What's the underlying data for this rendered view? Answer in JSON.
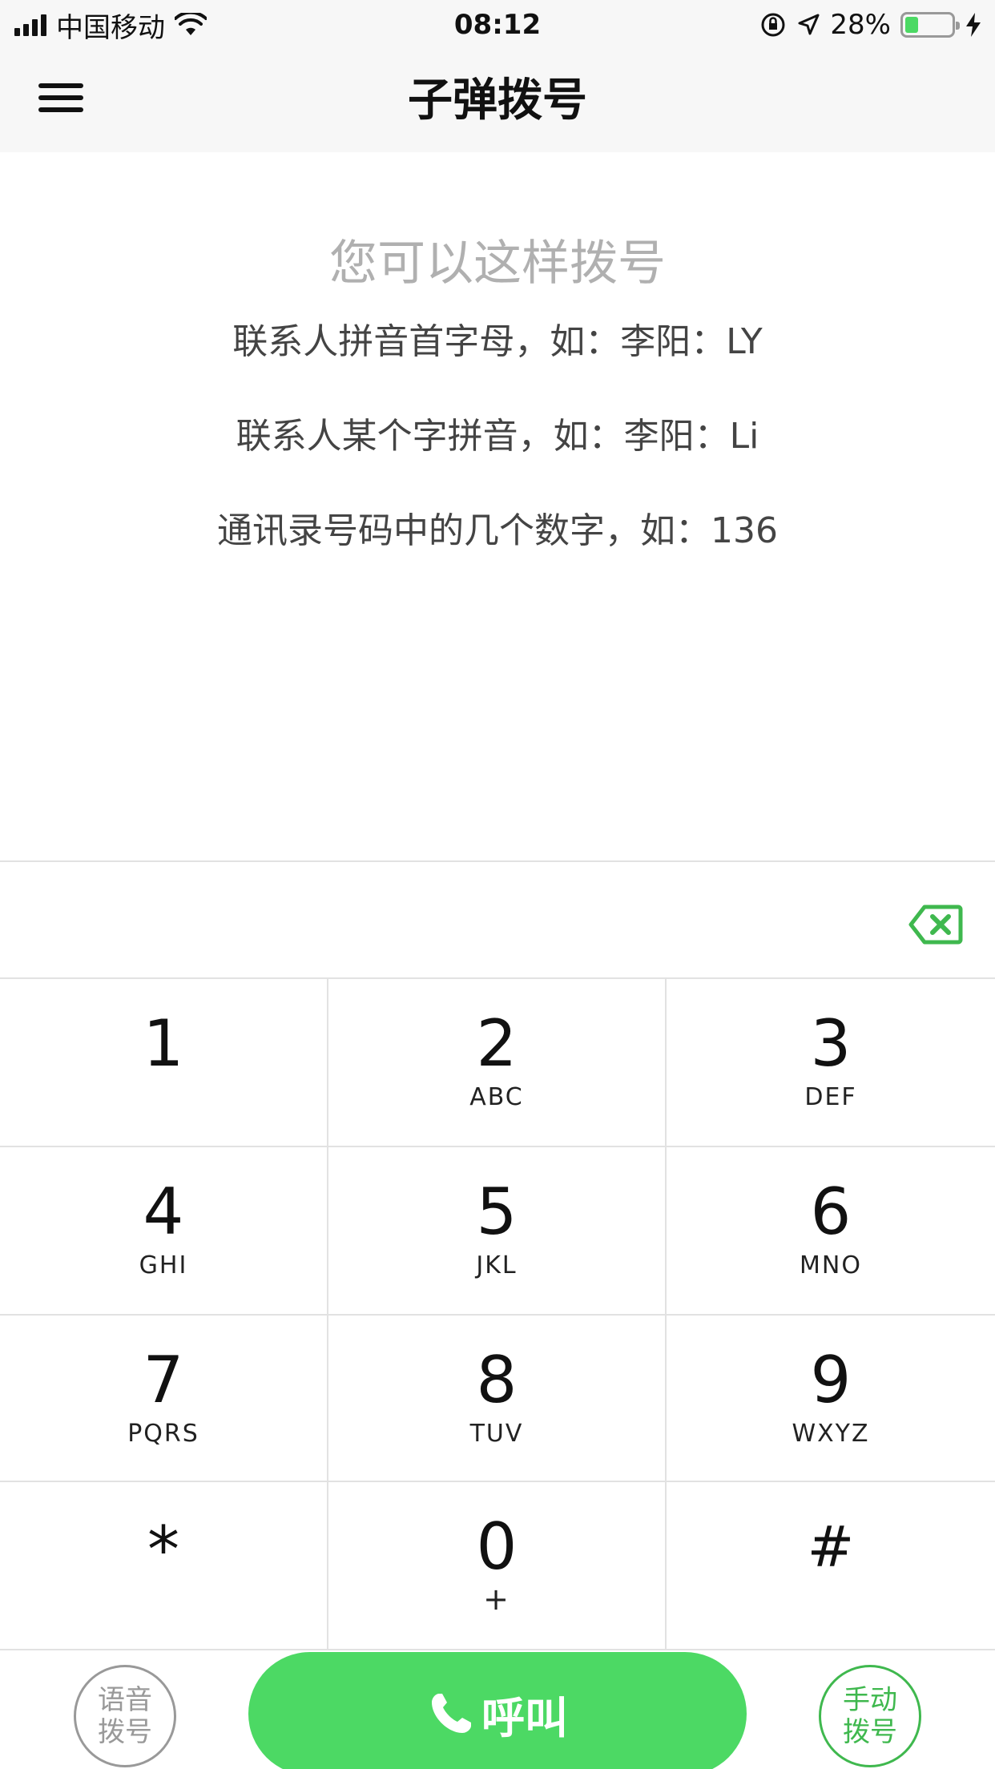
{
  "status_bar": {
    "carrier": "中国移动",
    "time": "08:12",
    "battery_percent": "28%",
    "battery_level": 0.28
  },
  "nav": {
    "title": "子弹拨号"
  },
  "hint": {
    "title": "您可以这样拨号",
    "lines": [
      "联系人拼音首字母，如：李阳：LY",
      "联系人某个字拼音，如：李阳：Li",
      "通讯录号码中的几个数字，如：136"
    ]
  },
  "keypad": {
    "keys": [
      {
        "digit": "1",
        "letters": ""
      },
      {
        "digit": "2",
        "letters": "ABC"
      },
      {
        "digit": "3",
        "letters": "DEF"
      },
      {
        "digit": "4",
        "letters": "GHI"
      },
      {
        "digit": "5",
        "letters": "JKL"
      },
      {
        "digit": "6",
        "letters": "MNO"
      },
      {
        "digit": "7",
        "letters": "PQRS"
      },
      {
        "digit": "8",
        "letters": "TUV"
      },
      {
        "digit": "9",
        "letters": "WXYZ"
      },
      {
        "digit": "*",
        "letters": ""
      },
      {
        "digit": "0",
        "letters": "+"
      },
      {
        "digit": "#",
        "letters": ""
      }
    ]
  },
  "bottom": {
    "voice_line1": "语音",
    "voice_line2": "拨号",
    "call_label": "呼叫",
    "manual_line1": "手动",
    "manual_line2": "拨号"
  },
  "colors": {
    "accent_green": "#4cd964",
    "manual_green": "#3fb84e",
    "hint_gray": "#b0b0b0"
  },
  "icons": [
    "signal-icon",
    "wifi-icon",
    "rotation-lock-icon",
    "location-arrow-icon",
    "battery-icon",
    "charging-bolt-icon",
    "menu-icon",
    "backspace-icon",
    "phone-icon"
  ]
}
